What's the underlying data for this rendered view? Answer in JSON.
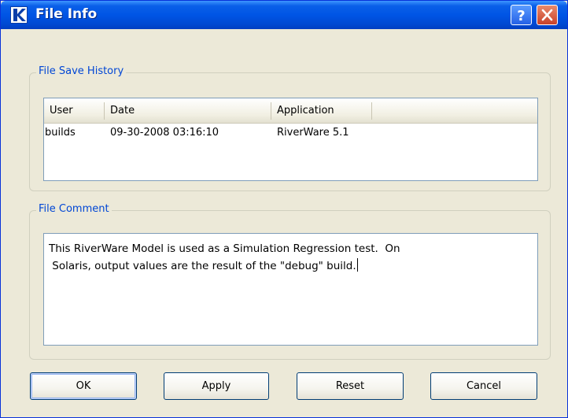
{
  "window": {
    "title": "File Info",
    "app_icon": "riverware-logo-icon",
    "help_icon": "help-icon",
    "close_icon": "close-icon"
  },
  "history": {
    "legend": "File Save History",
    "columns": [
      "User",
      "Date",
      "Application"
    ],
    "rows": [
      {
        "user": "builds",
        "date": "09-30-2008 03:16:10",
        "application": "RiverWare 5.1"
      }
    ]
  },
  "comment": {
    "legend": "File Comment",
    "text": "This RiverWare Model is used as a Simulation Regression test.  On\n Solaris, output values are the result of the \"debug\" build."
  },
  "buttons": {
    "ok": "OK",
    "apply": "Apply",
    "reset": "Reset",
    "cancel": "Cancel"
  },
  "colors": {
    "titlebar": "#0055e5",
    "legend_text": "#0046d5",
    "dialog_bg": "#ece9d8"
  }
}
